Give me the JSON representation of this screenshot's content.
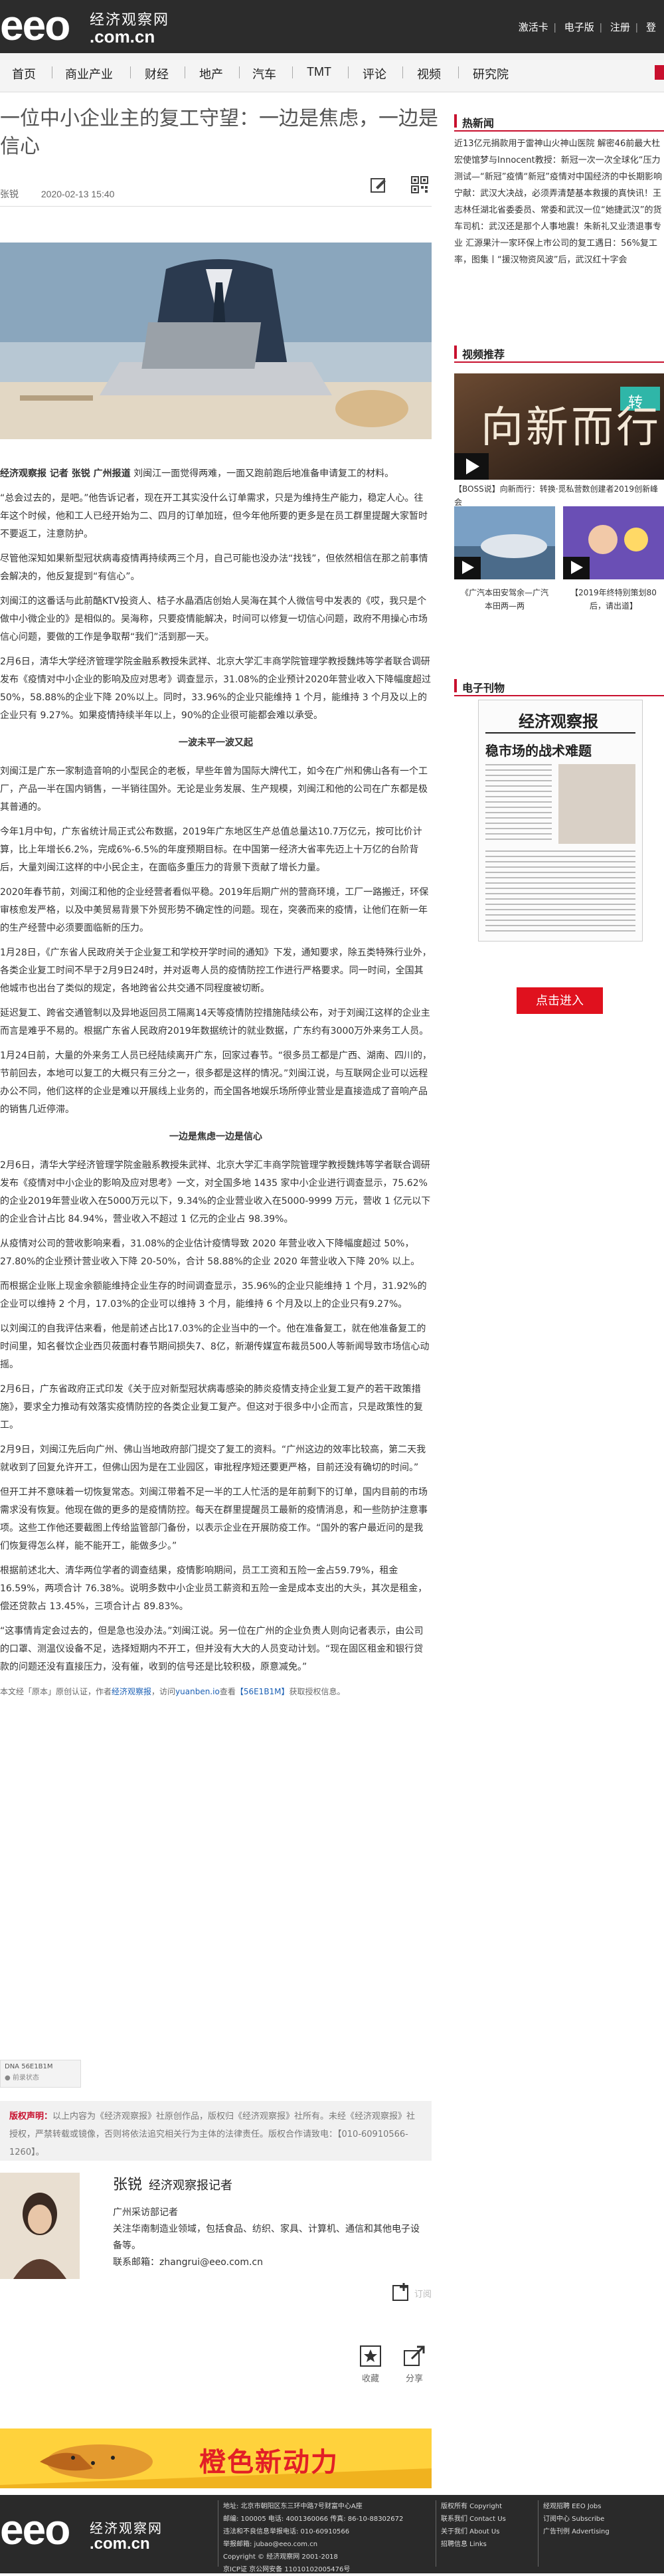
{
  "site": {
    "logo": "eeo",
    "logo_cn": "经济观察网",
    "logo_url": ".com.cn",
    "top_links": [
      "激活卡",
      "电子版",
      "注册",
      "登"
    ]
  },
  "nav": {
    "items": [
      "首页",
      "商业产业",
      "财经",
      "地产",
      "汽车",
      "TMT",
      "评论",
      "视频",
      "研究院"
    ]
  },
  "article": {
    "title": "一位中小企业主的复工守望：一边是焦虑，一边是信心",
    "author": "张锐",
    "date": "2020-02-13 15:40",
    "lead_bold": "经济观察报 记者 张锐 广州报道",
    "lead_text": "刘闽江一面觉得两难，一面又跑前跑后地准备申请复工的材料。",
    "paragraphs": [
      "“总会过去的，是吧。”他告诉记者，现在开工其实没什么订单需求，只是为维持生产能力，稳定人心。往年这个时候，他和工人已经开始为二、四月的订单加班，但今年他所要的更多是在员工群里提醒大家暂时不要返工，注意防护。",
      "尽管他深知如果新型冠状病毒疫情再持续两三个月，自己可能也没办法“找钱”，但依然相信在那之前事情会解决的，他反复提到“有信心”。",
      "刘闽江的这番话与此前酷KTV投资人、桔子水晶酒店创始人吴海在其个人微信号中发表的《哎，我只是个做中小微企业的》是相似的。吴海称，只要疫情能解决，时间可以修复一切信心问题，政府不用操心市场信心问题，要做的工作是争取帮“我们”活到那一天。",
      "2月6日，清华大学经济管理学院金融系教授朱武祥、北京大学汇丰商学院管理学教授魏炜等学者联合调研发布《疫情对中小企业的影响及应对思考》调查显示，31.08%的企业预计2020年营业收入下降幅度超过 50%，58.88%的企业下降 20%以上。同时，33.96%的企业只能维持 1 个月，能维持 3 个月及以上的企业只有 9.27%。如果疫情持续半年以上，90%的企业很可能都会难以承受。"
    ],
    "subhead1": "一波未平一波又起",
    "paragraphs2": [
      "刘闽江是广东一家制造音响的小型民企的老板，早些年曾为国际大牌代工，如今在广州和佛山各有一个工厂，产品一半在国内销售，一半销往国外。无论是业务发展、生产规模，刘闽江和他的公司在广东都是极其普通的。",
      "今年1月中旬，广东省统计局正式公布数据，2019年广东地区生产总值总量达10.7万亿元，按可比价计算，比上年增长6.2%，完成6%-6.5%的年度预期目标。在中国第一经济大省率先迈上十万亿的台阶背后，大量刘闽江这样的中小民企主，在面临多重压力的背景下贡献了增长力量。",
      "2020年春节前，刘闽江和他的企业经营者看似平稳。2019年后期广州的营商环境，工厂一路搬迁，环保审核愈发严格，以及中美贸易背景下外贸形势不确定性的问题。现在，突袭而来的疫情，让他们在新一年的生产经营中必须要面临新的压力。",
      "1月28日，《广东省人民政府关于企业复工和学校开学时间的通知》下发，通知要求，除五类特殊行业外，各类企业复工时间不早于2月9日24时，并对返粤人员的疫情防控工作进行严格要求。同一时间，全国其他城市也出台了类似的规定，各地跨省公共交通不同程度被切断。",
      "延迟复工、跨省交通管制以及异地返回员工隔离14天等疫情防控措施陆续公布，对于刘闽江这样的企业主而言是难乎不易的。根据广东省人民政府2019年数据统计的就业数据，广东约有3000万外来务工人员。",
      "1月24日前，大量的外来务工人员已经陆续离开广东，回家过春节。“很多员工都是广西、湖南、四川的，节前回去，本地可以复工的大概只有三分之一，很多都是这样的情况。”刘闽江说，与互联网企业可以远程办公不同，他们这样的企业是难以开展线上业务的，而全国各地娱乐场所停业营业是直接造成了音响产品的销售几近停滞。"
    ],
    "subhead2": "一边是焦虑一边是信心",
    "paragraphs3": [
      "2月6日，清华大学经济管理学院金融系教授朱武祥、北京大学汇丰商学院管理学教授魏炜等学者联合调研发布《疫情对中小企业的影响及应对思考》一文，对全国多地 1435 家中小企业进行调查显示，75.62%的企业2019年营业收入在5000万元以下，9.34%的企业营业收入在5000-9999 万元，营收 1 亿元以下的企业合计占比 84.94%，营业收入不超过 1 亿元的企业占 98.39%。",
      "从疫情对公司的营收影响来看，31.08%的企业估计疫情导致 2020 年营业收入下降幅度超过 50%，27.80%的企业预计营业收入下降 20-50%，合计 58.88%的企业 2020 年营业收入下降 20% 以上。",
      "而根据企业账上现金余额能维持企业生存的时间调查显示，35.96%的企业只能维持 1 个月，31.92%的企业可以维持 2 个月，17.03%的企业可以维持 3 个月，能维持 6 个月及以上的企业只有9.27%。",
      "以刘闽江的自我评估来看，他是前述占比17.03%的企业当中的一个。他在准备复工，就在他准备复工的时间里，知名餐饮企业西贝莜面村春节期间损失7、8亿，新潮传媒宣布裁员500人等新闻导致市场信心动摇。",
      "2月6日，广东省政府正式印发《关于应对新型冠状病毒感染的肺炎疫情支持企业复工复产的若干政策措施》，要求全力推动有效落实疫情防控的各类企业复工复产。但这对于很多中小企而言，只是政策性的复工。",
      "2月9日，刘闽江先后向广州、佛山当地政府部门提交了复工的资料。“广州这边的效率比较高，第二天我就收到了回复允许开工，但佛山因为是在工业园区，审批程序短还要更严格，目前还没有确切的时间。”",
      "但开工并不意味着一切恢复常态。刘闽江带着不足一半的工人忙活的是年前剩下的订单，国内目前的市场需求没有恢复。他现在做的更多的是疫情防控。每天在群里提醒员工最新的疫情消息，和一些防护注意事项。这些工作他还要截图上传给监管部门备份，以表示企业在开展防疫工作。“国外的客户最近问的是我们恢复得怎么样，能不能开工，能做多少。”",
      "根据前述北大、清华两位学者的调查结果，疫情影响期间，员工工资和五险一金占59.79%，租金 16.59%，两项合计 76.38%。说明多数中小企业员工薪资和五险一金是成本支出的大头，其次是租金，偿还贷款占 13.45%，三项合计占 89.83%。",
      "“这事情肯定会过去的，但是急也没办法。”刘闽江说。另一位在广州的企业负责人则向记者表示，由公司的口罩、测温仪设备不足，选择短期内不开工，但并没有大大的人员变动计划。“现在固区租金和银行贷款的问题还没有直接压力，没有催，收到的信号还是比较积极，原意减免。”"
    ],
    "end_note_prefix": "本文经「原本」原创认证，作者",
    "end_note_author": "经济观察报",
    "end_note_mid": "，访问",
    "end_note_link": "yuanben.io",
    "end_note_mid2": "查看",
    "end_note_code": "【56E1B1M】",
    "end_note_suffix": "获取授权信息。",
    "tag_dna": "DNA 56E1B1M",
    "tag_status": "● 前录状态",
    "copyright_label": "版权声明：",
    "copyright_text": "以上内容为《经济观察报》社原创作品，版权归《经济观察报》社所有。未经《经济观察报》社授权，严禁转载或镜像，否则将依法追究相关行为主体的法律责任。版权合作请致电：【010-60910566-1260】。"
  },
  "author_box": {
    "name": "张锐",
    "role": "经济观察报记者",
    "dept": "广州采访部记者",
    "bio": "关注华南制造业领域，包括食品、纺织、家具、计算机、通信和其他电子设备等。",
    "email_label": "联系邮箱：",
    "email": "zhangrui@eeo.com.cn",
    "follow_label": "订阅",
    "collect_label": "收藏",
    "share_label": "分享"
  },
  "sidebar": {
    "hot_title": "热新闻",
    "hot_text": "近13亿元捐款用于雷神山火神山医院 解密46前最大杜宏使馆梦与Innocent教授：新冠一次一次全球化“压力测试—“新冠”疫情“新冠”疫情对中国经济的中长期影响 宁献：武汉大决战，必须弄清楚基本救援的真快讯！王志林任湖北省委委员、常委和武汉一位“她捷武汉”的货车司机：武汉还是那个人事地震！朱新礼又业溃退事专业 汇源果汁一家环保上市公司的复工遇日：56%复工率，图集丨“援汉物资风波”后，武汉红十字会",
    "video_title": "视频推荐",
    "video_banner": "向新而行",
    "video_banner_tag": "转",
    "video_caption": "【BOSS说】向新而行：转换·觅私营数创建者2019创新峰会",
    "thumb1_caption": "《广汽本田安驾余—广汽本田两—两",
    "thumb2_caption": "【2019年终特别策划80后，请出道】",
    "epaper_title": "电子刊物",
    "epaper_name": "经济观察报",
    "epaper_headline": "稳市场的战术难题",
    "read_button": "点击进入"
  },
  "ad": {
    "text": "橙色新动力"
  },
  "footer": {
    "logo": "eeo",
    "logo_cn": "经济观察网",
    "logo_url": ".com.cn",
    "address": [
      "地址: 北京市朝阳区东三环中路7号财富中心A座",
      "邮编: 100005 电话: 4001360066 传真: 86-10-88302672",
      "违法和不良信息举报电话: 010-60910566",
      "举报邮箱: jubao@eeo.com.cn",
      "Copyright © 经济观察网 2001-2018",
      "京ICP证 京公网安备 11010102005476号"
    ],
    "col2": [
      "版权所有 Copyright",
      "联系我们 Contact Us",
      "关于我们 About Us",
      "招聘信息 Links"
    ],
    "col3": [
      "经观招聘 EEO Jobs",
      "订阅中心 Subscribe",
      "广告刊例 Advertising"
    ]
  }
}
